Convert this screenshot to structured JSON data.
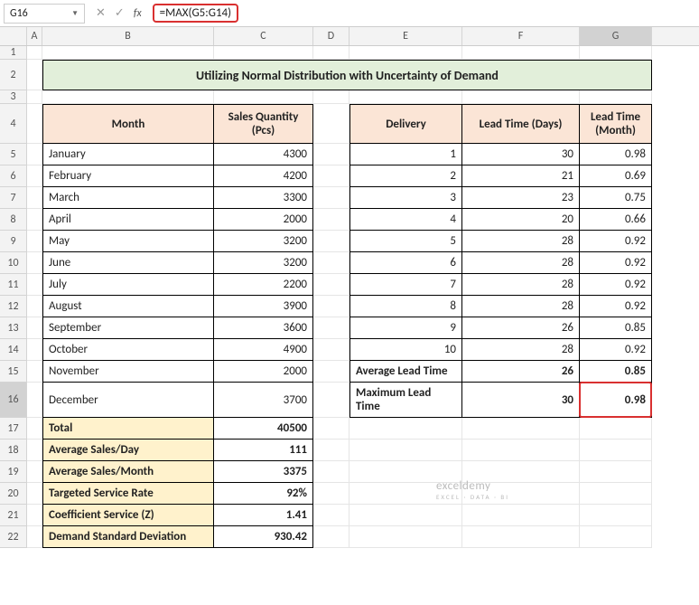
{
  "formula_bar": {
    "cell_ref": "G16",
    "formula": "=MAX(G5:G14)"
  },
  "col_headers": [
    "",
    "A",
    "B",
    "C",
    "D",
    "E",
    "F",
    "G"
  ],
  "title": "Utilizing Normal Distribution with Uncertainty of Demand",
  "left_table": {
    "hdr_month": "Month",
    "hdr_qty": "Sales Quantity (Pcs)",
    "rows": [
      {
        "m": "January",
        "q": "4300"
      },
      {
        "m": "February",
        "q": "4200"
      },
      {
        "m": "March",
        "q": "3300"
      },
      {
        "m": "April",
        "q": "2000"
      },
      {
        "m": "May",
        "q": "3200"
      },
      {
        "m": "June",
        "q": "3200"
      },
      {
        "m": "July",
        "q": "2200"
      },
      {
        "m": "August",
        "q": "3900"
      },
      {
        "m": "September",
        "q": "3600"
      },
      {
        "m": "October",
        "q": "4900"
      },
      {
        "m": "November",
        "q": "2000"
      },
      {
        "m": "December",
        "q": "3700"
      }
    ],
    "summary": [
      {
        "label": "Total",
        "val": "40500"
      },
      {
        "label": "Average Sales/Day",
        "val": "111"
      },
      {
        "label": "Average Sales/Month",
        "val": "3375"
      },
      {
        "label": "Targeted Service Rate",
        "val": "92%"
      },
      {
        "label": "Coefficient Service (Z)",
        "val": "1.41"
      },
      {
        "label": "Demand Standard Deviation",
        "val": "930.42"
      }
    ]
  },
  "right_table": {
    "hdr_del": "Delivery",
    "hdr_days": "Lead Time (Days)",
    "hdr_month": "Lead Time (Month)",
    "rows": [
      {
        "d": "1",
        "days": "30",
        "mon": "0.98"
      },
      {
        "d": "2",
        "days": "21",
        "mon": "0.69"
      },
      {
        "d": "3",
        "days": "23",
        "mon": "0.75"
      },
      {
        "d": "4",
        "days": "20",
        "mon": "0.66"
      },
      {
        "d": "5",
        "days": "28",
        "mon": "0.92"
      },
      {
        "d": "6",
        "days": "28",
        "mon": "0.92"
      },
      {
        "d": "7",
        "days": "28",
        "mon": "0.92"
      },
      {
        "d": "8",
        "days": "28",
        "mon": "0.92"
      },
      {
        "d": "9",
        "days": "26",
        "mon": "0.85"
      },
      {
        "d": "10",
        "days": "28",
        "mon": "0.92"
      }
    ],
    "avg_label": "Average Lead Time",
    "avg_days": "26",
    "avg_mon": "0.85",
    "max_label": "Maximum Lead Time",
    "max_days": "30",
    "max_mon": "0.98"
  },
  "row_numbers": [
    "1",
    "2",
    "3",
    "4",
    "5",
    "6",
    "7",
    "8",
    "9",
    "10",
    "11",
    "12",
    "13",
    "14",
    "15",
    "16",
    "17",
    "18",
    "19",
    "20",
    "21",
    "22"
  ],
  "watermark": {
    "main": "exceldemy",
    "sub": "EXCEL · DATA · BI"
  }
}
